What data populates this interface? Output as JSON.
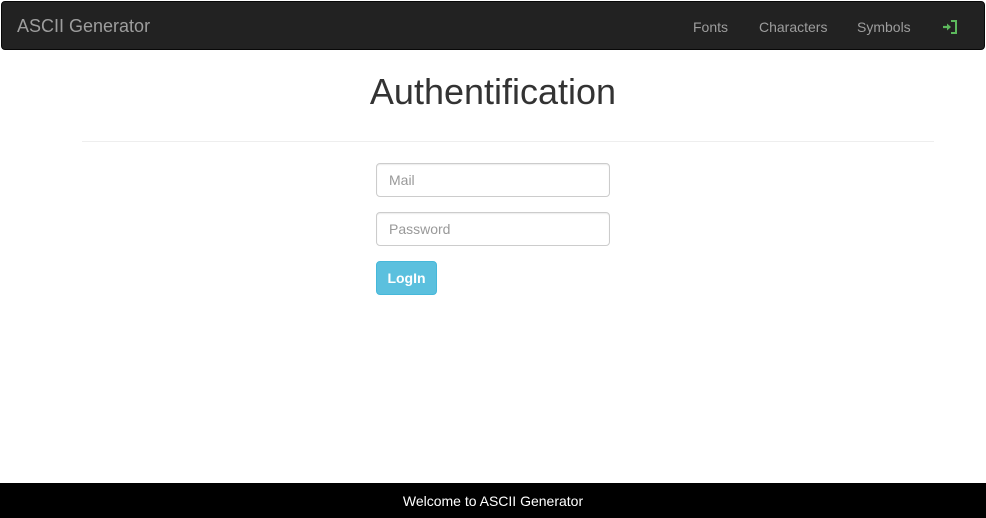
{
  "navbar": {
    "brand": "ASCII Generator",
    "links": [
      {
        "label": "Fonts"
      },
      {
        "label": "Characters"
      },
      {
        "label": "Symbols"
      }
    ],
    "login_icon": "sign-in-icon",
    "login_icon_color": "#5cb85c",
    "background": "#222222"
  },
  "main": {
    "title": "Authentification",
    "form": {
      "mail_placeholder": "Mail",
      "password_placeholder": "Password",
      "submit_label": "LogIn",
      "submit_color": "#5bc0de"
    }
  },
  "footer": {
    "text": "Welcome to ASCII Generator",
    "background": "#000000"
  }
}
